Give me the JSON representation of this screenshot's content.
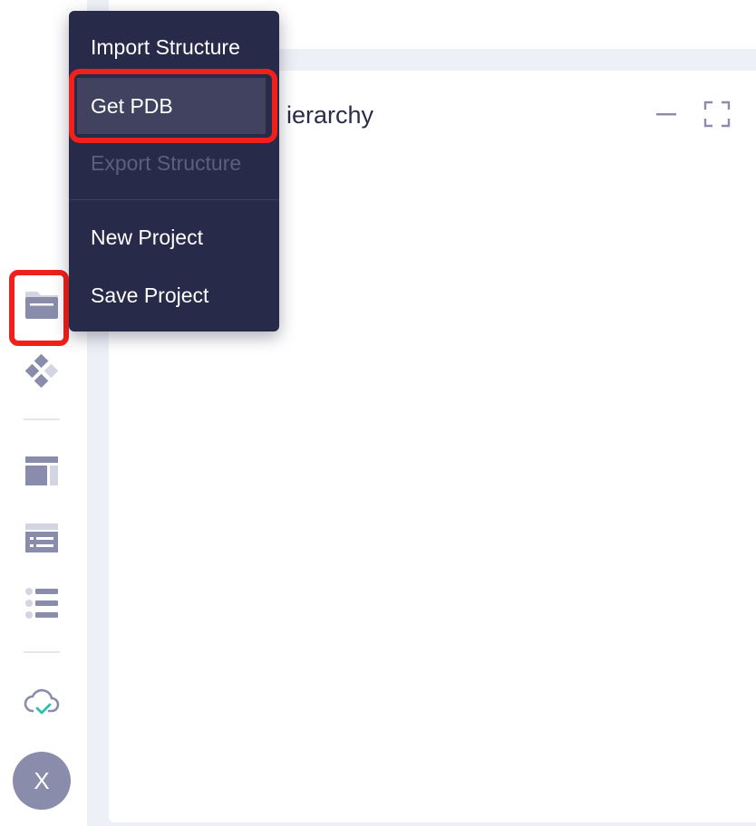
{
  "panel": {
    "title": "ierarchy",
    "minimize_icon": "minimize-icon",
    "fullscreen_icon": "fullscreen-icon"
  },
  "file_menu": {
    "items": [
      {
        "label": "Import Structure",
        "state": "enabled"
      },
      {
        "label": "Get PDB",
        "state": "highlighted"
      },
      {
        "label": "Export Structure",
        "state": "disabled"
      },
      {
        "label": "New Project",
        "state": "enabled"
      },
      {
        "label": "Save Project",
        "state": "enabled"
      }
    ]
  },
  "sidebar": {
    "icons": [
      "folder-icon",
      "components-icon",
      "layout-icon",
      "list-detail-icon",
      "list-icon",
      "cloud-sync-icon"
    ]
  },
  "user": {
    "avatar_initial": "X"
  },
  "colors": {
    "menu_bg": "#272a49",
    "menu_active": "#40425f",
    "icon": "#8a8cab",
    "highlight": "#f0201a",
    "sync_check": "#2bbfb3"
  }
}
